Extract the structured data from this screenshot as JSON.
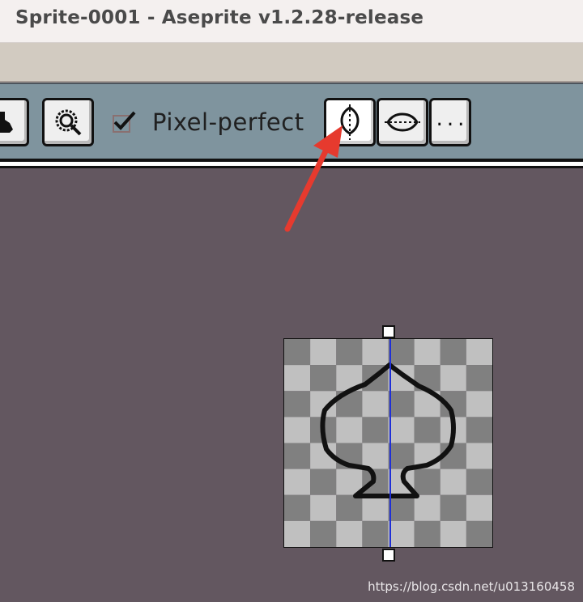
{
  "window": {
    "title": "Sprite-0001 - Aseprite v1.2.28-release"
  },
  "context_bar": {
    "pixel_perfect_label": "Pixel-perfect",
    "pixel_perfect_checked": true,
    "more_button_label": "...",
    "buttons": [
      {
        "name": "ink-button",
        "icon": "ink-drop-icon"
      },
      {
        "name": "sample-button",
        "icon": "magnifier-icon"
      },
      {
        "name": "vertical-symmetry-button",
        "icon": "vertical-symmetry-icon",
        "selected": true
      },
      {
        "name": "horizontal-symmetry-button",
        "icon": "horizontal-symmetry-icon"
      },
      {
        "name": "symmetry-options-button",
        "icon": "more-icon"
      }
    ]
  },
  "annotation": {
    "arrow_color": "#e63a2e",
    "points_to": "vertical-symmetry-button"
  },
  "canvas": {
    "checker_light": "#c0c0c0",
    "checker_dark": "#808080",
    "symmetry_axis_color": "#1f2fd6",
    "drawing": "spade outline"
  },
  "watermark": "https://blog.csdn.net/u013160458"
}
